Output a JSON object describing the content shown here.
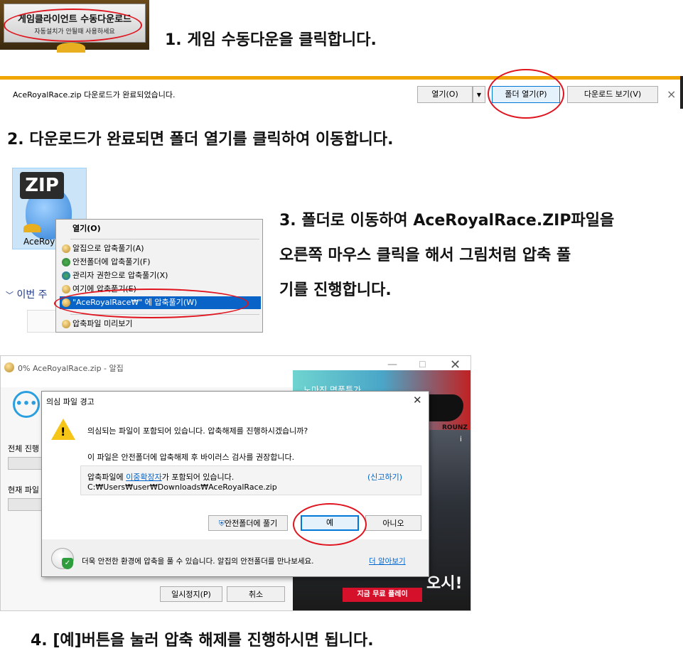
{
  "step1": {
    "banner_title": "게임클라이언트 수동다운로드",
    "banner_sub": "자동설치가 안될때 사용하세요",
    "text": "1. 게임 수동다운을 클릭합니다."
  },
  "download_bar": {
    "message": "AceRoyalRace.zip 다운로드가 완료되었습니다.",
    "open_label": "열기(O)",
    "folder_label": "폴더 열기(P)",
    "view_label": "다운로드 보기(V)",
    "close_glyph": "×"
  },
  "step2": {
    "text": "2. 다운로드가 완료되면 폴더 열기를 클릭하여 이동합니다."
  },
  "zip_area": {
    "badge": "ZIP",
    "file_label": "AceRoya",
    "week_label": "이번 주",
    "menu": [
      "열기(O)",
      "알집으로 압축풀기(A)",
      "안전폴더에 압축풀기(F)",
      "관리자 권한으로 압축풀기(X)",
      "여기에 압축풀기(E)",
      "\"AceRoyalRace₩\" 에 압축풀기(W)",
      "압축파일 미리보기"
    ]
  },
  "step3": {
    "line1": "3. 폴더로 이동하여 AceRoyalRace.ZIP파일을",
    "line2": "오른쪽 마우스 클릭을 해서 그림처럼 압축 풀",
    "line3": "기를 진행합니다."
  },
  "alzip": {
    "title": "0% AceRoyalRace.zip - 알집",
    "total_label": "전체 진행",
    "current_label": "현재 파일",
    "pause_label": "일시정지(P)",
    "cancel_label": "취소",
    "ad_top": "노마진 명품특가",
    "ad_brand": "ROUNZ",
    "ad_headline": "지금 무료 플레이",
    "ad_slogan": "오시!"
  },
  "dialog": {
    "title": "의심 파일 경고",
    "main_text": "의심되는 파일이 포함되어 있습니다. 압축해제를 진행하시겠습니까?",
    "sub_text": "이 파일은 안전폴더에 압축해제 후 바이러스 검사를 권장합니다.",
    "info_prefix": "압축파일에 ",
    "info_link": "이중확장자",
    "info_suffix": "가 포함되어 있습니다.",
    "report_link": "(신고하기)",
    "path": "C:₩Users₩user₩Downloads₩AceRoyalRace.zip",
    "safe_button": "안전폴더에 풀기",
    "yes_button": "예",
    "no_button": "아니오",
    "footer_text": "더욱 안전한 환경에 압축을 풀 수 있습니다. 알집의 안전폴더를 만나보세요.",
    "footer_link": "더 알아보기"
  },
  "step4": {
    "text": "4. [예]버튼을 눌러 압축 해제를 진행하시면 됩니다."
  },
  "colors": {
    "highlight_ring": "#e0141e",
    "accent_bar": "#f0a500",
    "menu_selected": "#0a64c8"
  }
}
